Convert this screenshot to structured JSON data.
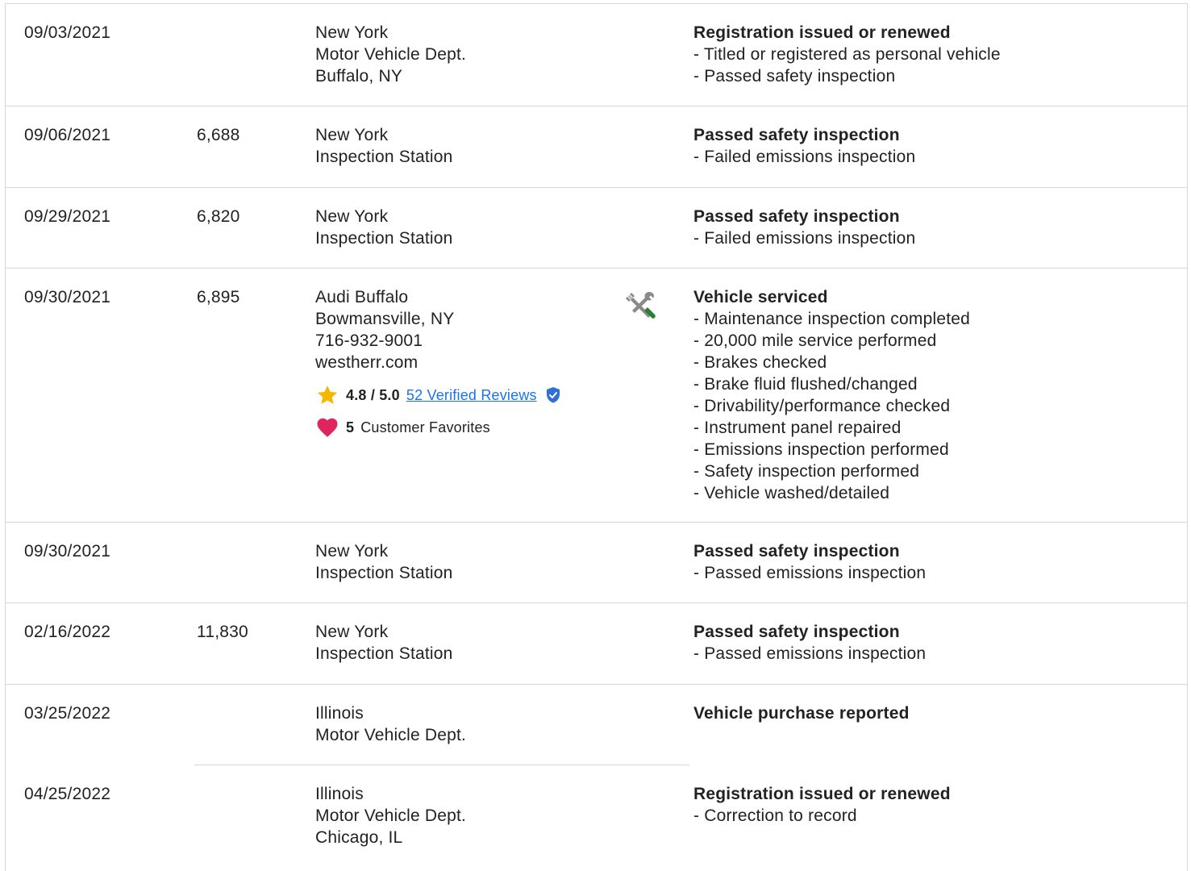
{
  "records": [
    {
      "date": "09/03/2021",
      "odometer": "",
      "source": [
        "New York",
        "Motor Vehicle Dept.",
        "Buffalo, NY"
      ],
      "title": "Registration issued or renewed",
      "items": [
        "- Titled or registered as personal vehicle",
        "- Passed safety inspection"
      ]
    },
    {
      "date": "09/06/2021",
      "odometer": "6,688",
      "source": [
        "New York",
        "Inspection Station"
      ],
      "title": "Passed safety inspection",
      "items": [
        "- Failed emissions inspection"
      ]
    },
    {
      "date": "09/29/2021",
      "odometer": "6,820",
      "source": [
        "New York",
        "Inspection Station"
      ],
      "title": "Passed safety inspection",
      "items": [
        "- Failed emissions inspection"
      ]
    },
    {
      "date": "09/30/2021",
      "odometer": "6,895",
      "source": [
        "Audi Buffalo",
        "Bowmansville, NY",
        "716-932-9001",
        "westherr.com"
      ],
      "rating": {
        "score": "4.8 / 5.0",
        "reviews_link": "52 Verified Reviews",
        "favorites_count": "5",
        "favorites_label": "Customer Favorites"
      },
      "icon": "service-tools-icon",
      "title": "Vehicle serviced",
      "items": [
        "- Maintenance inspection completed",
        "- 20,000 mile service performed",
        "- Brakes checked",
        "- Brake fluid flushed/changed",
        "- Drivability/performance checked",
        "- Instrument panel repaired",
        "- Emissions inspection performed",
        "- Safety inspection performed",
        "- Vehicle washed/detailed"
      ]
    },
    {
      "date": "09/30/2021",
      "odometer": "",
      "source": [
        "New York",
        "Inspection Station"
      ],
      "title": "Passed safety inspection",
      "items": [
        "- Passed emissions inspection"
      ]
    },
    {
      "date": "02/16/2022",
      "odometer": "11,830",
      "source": [
        "New York",
        "Inspection Station"
      ],
      "title": "Passed safety inspection",
      "items": [
        "- Passed emissions inspection"
      ]
    },
    {
      "date": "03/25/2022",
      "odometer": "",
      "source": [
        "Illinois",
        "Motor Vehicle Dept."
      ],
      "title": "Vehicle purchase reported",
      "items": []
    },
    {
      "date": "04/25/2022",
      "odometer": "",
      "source": [
        "Illinois",
        "Motor Vehicle Dept.",
        "Chicago, IL"
      ],
      "title": "Registration issued or renewed",
      "items": [
        "- Correction to record"
      ]
    }
  ],
  "colors": {
    "link": "#1a73e8",
    "star": "#f5b800",
    "heart": "#e0245e",
    "verified": "#2f6fd6",
    "tool_green": "#2e7d32",
    "tool_grey": "#8a8a8a"
  }
}
